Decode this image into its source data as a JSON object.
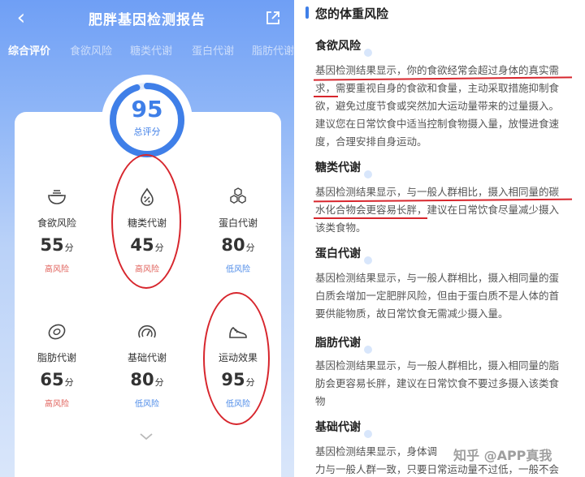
{
  "header": {
    "title": "肥胖基因检测报告"
  },
  "tabs": [
    {
      "label": "综合评价",
      "active": true
    },
    {
      "label": "食欲风险"
    },
    {
      "label": "糖类代谢"
    },
    {
      "label": "蛋白代谢"
    },
    {
      "label": "脂肪代谢"
    }
  ],
  "score": {
    "value": "95",
    "label": "总评分",
    "progress": 0.95
  },
  "metrics": [
    {
      "name": "食欲风险",
      "value": "55",
      "unit": "分",
      "risk": "高风险",
      "level": "high",
      "icon": "bowl-icon"
    },
    {
      "name": "糖类代谢",
      "value": "45",
      "unit": "分",
      "risk": "高风险",
      "level": "high",
      "icon": "drop-percent-icon"
    },
    {
      "name": "蛋白代谢",
      "value": "80",
      "unit": "分",
      "risk": "低风险",
      "level": "low",
      "icon": "hexagons-icon"
    },
    {
      "name": "脂肪代谢",
      "value": "65",
      "unit": "分",
      "risk": "高风险",
      "level": "high",
      "icon": "fat-cell-icon"
    },
    {
      "name": "基础代谢",
      "value": "80",
      "unit": "分",
      "risk": "低风险",
      "level": "low",
      "icon": "gauge-icon"
    },
    {
      "name": "运动效果",
      "value": "95",
      "unit": "分",
      "risk": "低风险",
      "level": "low",
      "icon": "shoe-icon"
    }
  ],
  "colors": {
    "accent": "#3f7fe8",
    "high_risk": "#e0605a",
    "low_risk": "#4c8ae8",
    "annotation": "#d7262d"
  },
  "article": {
    "section_title": "您的体重风险",
    "items": [
      {
        "title": "食欲风险",
        "lines": [
          "基因检测结果显示，你的食欲经常会超过身体的真实需",
          "求，需要重视自身的食欲和食量，主动采取措施抑制食",
          "欲，避免过度节食或突然加大运动量带来的过量摄入。",
          "建议您在日常饮食中适当控制食物摄入量，放慢进食速",
          "度，合理安排自身运动。"
        ]
      },
      {
        "title": "糖类代谢",
        "lines": [
          "基因检测结果显示，与一般人群相比，摄入相同量的碳",
          "水化合物会更容易长胖，建议在日常饮食尽量减少摄入",
          "该类食物。"
        ]
      },
      {
        "title": "蛋白代谢",
        "lines": [
          "基因检测结果显示，与一般人群相比，摄入相同量的蛋",
          "白质会增加一定肥胖风险，但由于蛋白质不是人体的首",
          "要供能物质，故日常饮食无需减少摄入量。"
        ]
      },
      {
        "title": "脂肪代谢",
        "lines": [
          "基因检测结果显示，与一般人群相比，摄入相同量的脂",
          "肪会更容易长胖，建议在日常饮食不要过多摄入该类食",
          "物"
        ]
      },
      {
        "title": "基础代谢",
        "lines": [
          "基因检测结果显示，身体调",
          "力与一般人群一致，只要日常运动量不过低，一般不会"
        ]
      }
    ]
  },
  "watermark": "知乎 @APP真我"
}
